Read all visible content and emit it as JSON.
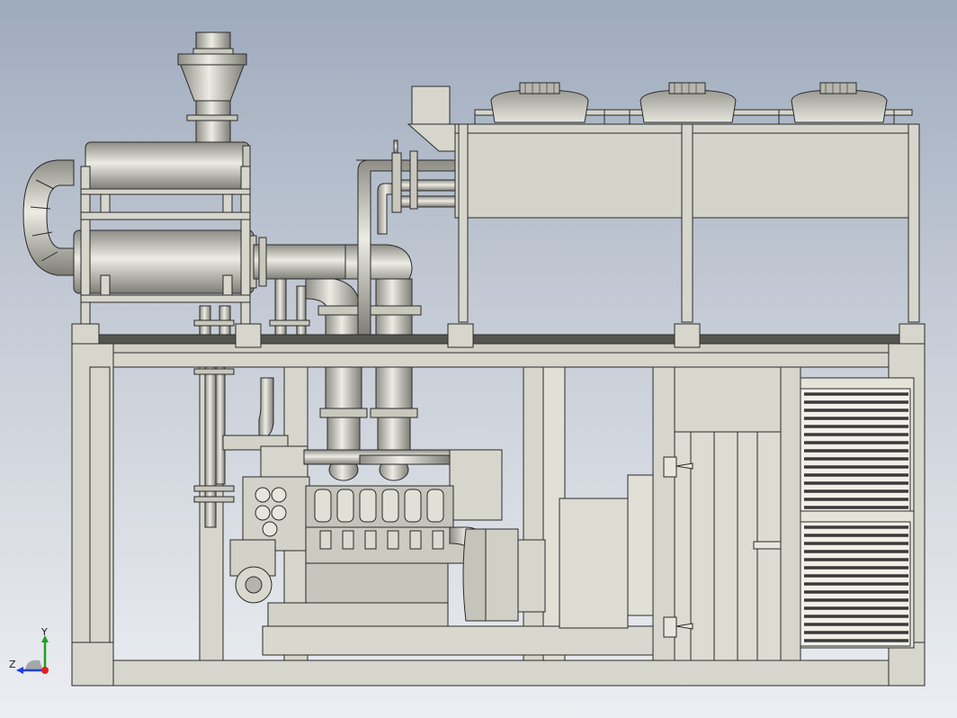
{
  "viewport": {
    "background_top": "#9eabbe",
    "background_bottom": "#eceef2",
    "model_fill": "#c8c8bc",
    "model_fill_light": "#dcdcd2",
    "model_stroke": "#2a2a2a",
    "louver_dark": "#3a3a3a"
  },
  "triad": {
    "x_label": "",
    "y_label": "Y",
    "z_label": "Z",
    "x_color": "#e02020",
    "y_color": "#20a020",
    "z_color": "#2040e0"
  },
  "model": {
    "name_icon": "genset-container-icon",
    "fan_count": 3,
    "engine_cylinders_visible": 6,
    "louver_panels": 2
  }
}
